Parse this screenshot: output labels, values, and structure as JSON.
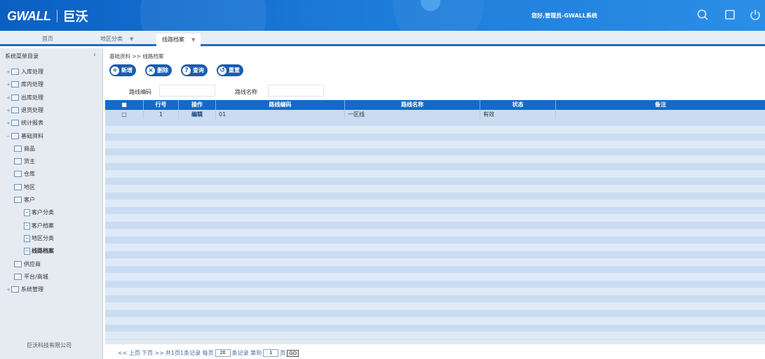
{
  "header": {
    "logo_mark": "GWALL",
    "logo_cn": "巨沃",
    "user_info": "您好,管理员-GWALL系统"
  },
  "tabs": [
    {
      "label": "首页",
      "closable": false
    },
    {
      "label": "地区分类",
      "closable": true
    },
    {
      "label": "线路档案",
      "closable": true
    }
  ],
  "sidebar": {
    "title": "系统菜单目录",
    "collapse": "‹",
    "items": [
      {
        "label": "入库处理",
        "toggle": "+",
        "level": 0,
        "kind": "folder"
      },
      {
        "label": "库内处理",
        "toggle": "+",
        "level": 0,
        "kind": "folder"
      },
      {
        "label": "出库处理",
        "toggle": "+",
        "level": 0,
        "kind": "folder"
      },
      {
        "label": "退货处理",
        "toggle": "+",
        "level": 0,
        "kind": "folder"
      },
      {
        "label": "统计报表",
        "toggle": "+",
        "level": 0,
        "kind": "folder"
      },
      {
        "label": "基础资料",
        "toggle": "−",
        "level": 0,
        "kind": "folder"
      },
      {
        "label": "商品",
        "toggle": "",
        "level": 1,
        "kind": "folder"
      },
      {
        "label": "货主",
        "toggle": "",
        "level": 1,
        "kind": "folder"
      },
      {
        "label": "仓库",
        "toggle": "",
        "level": 1,
        "kind": "folder"
      },
      {
        "label": "地区",
        "toggle": "",
        "level": 1,
        "kind": "folder"
      },
      {
        "label": "客户",
        "toggle": "",
        "level": 1,
        "kind": "folder"
      },
      {
        "label": "客户分类",
        "toggle": "",
        "level": 2,
        "kind": "page"
      },
      {
        "label": "客户档案",
        "toggle": "",
        "level": 2,
        "kind": "page"
      },
      {
        "label": "地区分类",
        "toggle": "",
        "level": 2,
        "kind": "page"
      },
      {
        "label": "线路档案",
        "toggle": "",
        "level": 2,
        "kind": "page",
        "selected": true
      },
      {
        "label": "供应商",
        "toggle": "",
        "level": 1,
        "kind": "folder"
      },
      {
        "label": "平台/商城",
        "toggle": "",
        "level": 1,
        "kind": "folder"
      },
      {
        "label": "系统管理",
        "toggle": "+",
        "level": 0,
        "kind": "folder"
      }
    ],
    "footer": "巨沃科技有限公司"
  },
  "main": {
    "breadcrumb": "基础资料 >> 线路档案",
    "buttons": [
      {
        "label": "新增",
        "icon": "+"
      },
      {
        "label": "删除",
        "icon": "×"
      },
      {
        "label": "查询",
        "icon": "?"
      },
      {
        "label": "重置",
        "icon": "↺"
      }
    ],
    "filters": [
      {
        "label": "路线编码",
        "value": ""
      },
      {
        "label": "路线名称",
        "value": ""
      }
    ],
    "table": {
      "columns": [
        "",
        "行号",
        "操作",
        "路线编码",
        "路线名称",
        "状态",
        "备注"
      ],
      "rows": [
        {
          "check": "",
          "row_no": "1",
          "action": "编辑",
          "code": "01",
          "name": "一区线",
          "status": "有效",
          "remark": ""
        }
      ]
    },
    "pager": {
      "prev": "<< 上页",
      "next": "下页 >>",
      "summary": "共1页1条记录 每页",
      "per_page": "20",
      "per_page_suffix": "条记录 第到",
      "goto_page": "1",
      "page_suffix": "页",
      "go": "GO"
    }
  }
}
